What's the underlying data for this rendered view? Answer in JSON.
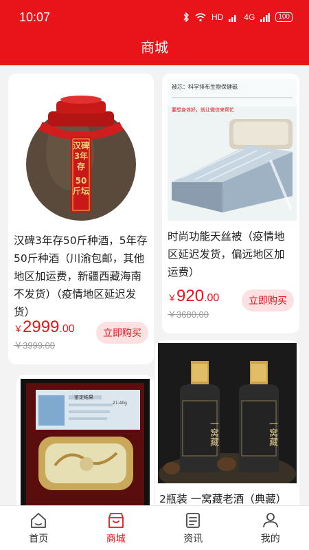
{
  "status_bar": {
    "time": "10:07",
    "network": "HD",
    "signal": "4G",
    "battery": "100"
  },
  "header": {
    "title": "商城"
  },
  "products": [
    {
      "name": "汉碑3年存50斤种酒，5年存50斤种酒（川渝包邮，其他地区加运费，新疆西藏海南不发货）（疫情地区延迟发货）",
      "currency": "￥",
      "price_int": "2999",
      "price_dec": ".00",
      "original_price": "￥3999.00",
      "buy_label": "立即购买",
      "image_text": {
        "brand": "汉碑",
        "line1": "汉碑",
        "line2": "3年存",
        "line3": "50",
        "line4": "斤坛"
      }
    },
    {
      "name": "时尚功能天丝被（疫情地区延迟发货，偏远地区加运费）",
      "currency": "￥",
      "price_int": "920",
      "price_dec": ".00",
      "original_price": "￥3680.00",
      "buy_label": "立即购买",
      "image_text": {
        "heading": "被芯：科学排布生物保健磁",
        "tagline": "要想身体好，就让微信来帮忙"
      }
    },
    {
      "name": "",
      "image_text": {
        "card_title": "鉴定结果",
        "card_weight": "21.40g"
      }
    },
    {
      "name": "2瓶装 一窝藏老酒（典藏）",
      "image_text": {
        "label": "一窝藏"
      }
    }
  ],
  "tabs": [
    {
      "label": "首页",
      "icon": "home-icon",
      "active": false
    },
    {
      "label": "商城",
      "icon": "shop-icon",
      "active": true
    },
    {
      "label": "资讯",
      "icon": "news-icon",
      "active": false
    },
    {
      "label": "我的",
      "icon": "profile-icon",
      "active": false
    }
  ],
  "colors": {
    "primary": "#e8141a",
    "buy_bg": "#fde0e1",
    "background": "#f3f3f3"
  }
}
